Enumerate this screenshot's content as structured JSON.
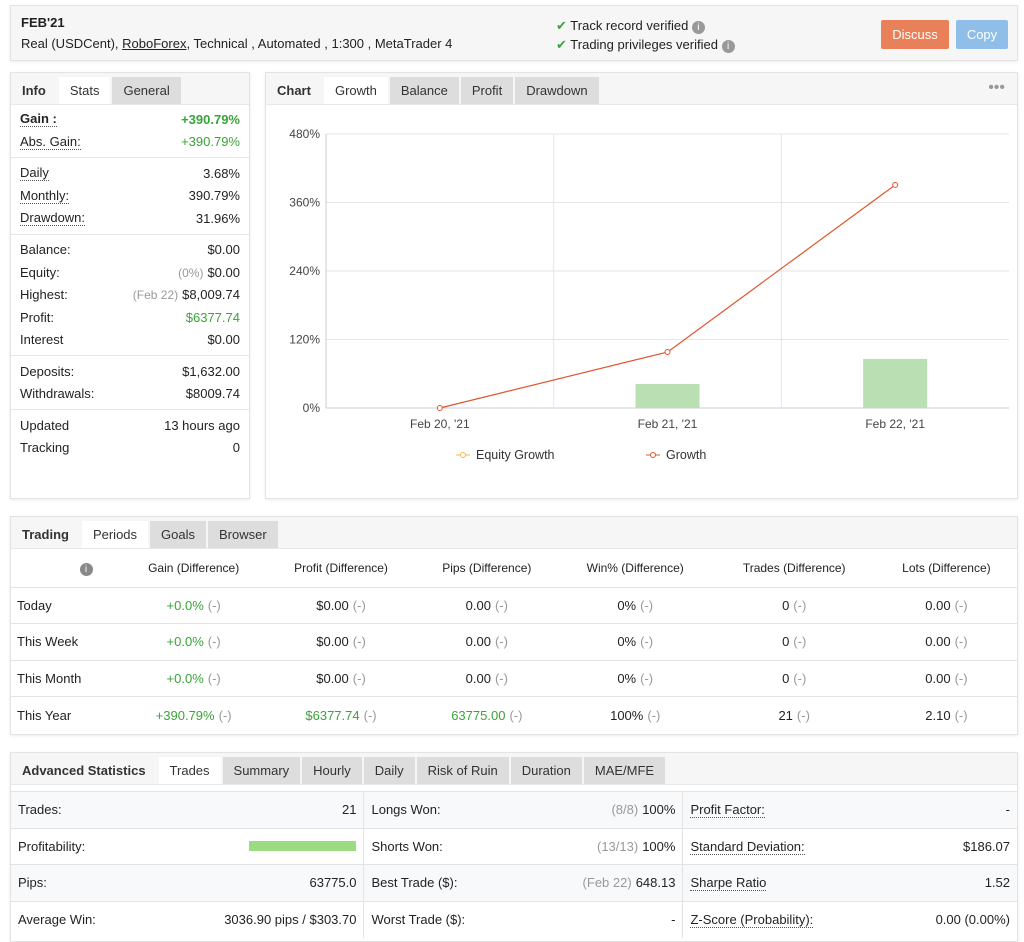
{
  "header": {
    "title": "FEB'21",
    "account_type": "Real (USDCent),",
    "broker": "RoboForex",
    "details": ", Technical , Automated , 1:300 , MetaTrader 4",
    "verified": [
      "Track record verified",
      "Trading privileges verified"
    ],
    "discuss": "Discuss",
    "copy": "Copy",
    "colors": {
      "discuss": "#e8805a",
      "copy": "#8fbfe9"
    }
  },
  "stats": {
    "tabs": [
      "Info",
      "Stats",
      "General"
    ],
    "active_tab": "Stats",
    "groups": [
      [
        {
          "label": "Gain :",
          "value": "+390.79%",
          "green": true,
          "bold": true
        },
        {
          "label": "Abs. Gain:",
          "value": "+390.79%",
          "green": true
        }
      ],
      [
        {
          "label": "Daily",
          "value": "3.68%"
        },
        {
          "label": "Monthly:",
          "value": "390.79%"
        },
        {
          "label": "Drawdown:",
          "value": "31.96%"
        }
      ],
      [
        {
          "label": "Balance:",
          "value": "$0.00"
        },
        {
          "label": "Equity:",
          "note": "(0%)",
          "value": "$0.00"
        },
        {
          "label": "Highest:",
          "note": "(Feb 22)",
          "value": "$8,009.74"
        },
        {
          "label": "Profit:",
          "value": "$6377.74",
          "green": true
        },
        {
          "label": "Interest",
          "value": "$0.00"
        }
      ],
      [
        {
          "label": "Deposits:",
          "value": "$1,632.00"
        },
        {
          "label": "Withdrawals:",
          "value": "$8009.74"
        }
      ],
      [
        {
          "label": "Updated",
          "value": "13 hours ago"
        },
        {
          "label": "Tracking",
          "value": "0"
        }
      ]
    ]
  },
  "chart": {
    "tabs": [
      "Chart",
      "Growth",
      "Balance",
      "Profit",
      "Drawdown"
    ],
    "active_tab": "Growth",
    "menu_icon": "more-dots-icon"
  },
  "chart_data": {
    "type": "line",
    "categories": [
      "Feb 20, '21",
      "Feb 21, '21",
      "Feb 22, '21"
    ],
    "ylim": [
      0,
      480
    ],
    "yticks": [
      "0%",
      "120%",
      "240%",
      "360%",
      "480%"
    ],
    "grid": true,
    "legend_position": "bottom",
    "series": [
      {
        "name": "Equity Growth",
        "color": "#f5b74a",
        "values": []
      },
      {
        "name": "Growth",
        "color": "#e2542c",
        "values": [
          0,
          98,
          390.79
        ]
      },
      {
        "type": "bar",
        "color": "#b9dfb2",
        "values": [
          0,
          42,
          86
        ]
      }
    ]
  },
  "trading": {
    "tabs": [
      "Trading",
      "Periods",
      "Goals",
      "Browser"
    ],
    "active_tab": "Periods",
    "columns": [
      "Gain (Difference)",
      "Profit (Difference)",
      "Pips (Difference)",
      "Win% (Difference)",
      "Trades (Difference)",
      "Lots (Difference)"
    ],
    "rows": [
      {
        "label": "Today",
        "cells": [
          "+0.0%",
          "$0.00",
          "0.00",
          "0%",
          "0",
          "0.00"
        ]
      },
      {
        "label": "This Week",
        "cells": [
          "+0.0%",
          "$0.00",
          "0.00",
          "0%",
          "0",
          "0.00"
        ]
      },
      {
        "label": "This Month",
        "cells": [
          "+0.0%",
          "$0.00",
          "0.00",
          "0%",
          "0",
          "0.00"
        ]
      },
      {
        "label": "This Year",
        "cells": [
          "+390.79%",
          "$6377.74",
          "63775.00",
          "100%",
          "21",
          "2.10"
        ]
      }
    ],
    "diff": "(-)"
  },
  "advanced": {
    "tabs": [
      "Advanced Statistics",
      "Trades",
      "Summary",
      "Hourly",
      "Daily",
      "Risk of Ruin",
      "Duration",
      "MAE/MFE"
    ],
    "active_tab": "Trades",
    "profitability": 1.0,
    "rows": [
      [
        {
          "l": "Trades:",
          "v": "21"
        },
        {
          "l": "Longs Won:",
          "n": "(8/8)",
          "v": "100%"
        },
        {
          "l": "Profit Factor:",
          "v": "-"
        }
      ],
      [
        {
          "l": "Profitability:",
          "v": ""
        },
        {
          "l": "Shorts Won:",
          "n": "(13/13)",
          "v": "100%"
        },
        {
          "l": "Standard Deviation:",
          "v": "$186.07"
        }
      ],
      [
        {
          "l": "Pips:",
          "v": "63775.0"
        },
        {
          "l": "Best Trade ($):",
          "n": "(Feb 22)",
          "v": "648.13"
        },
        {
          "l": "Sharpe Ratio",
          "v": "1.52"
        }
      ],
      [
        {
          "l": "Average Win:",
          "v": "3036.90 pips / $303.70"
        },
        {
          "l": "Worst Trade ($):",
          "v": "-"
        },
        {
          "l": "Z-Score (Probability):",
          "v": "0.00 (0.00%)"
        }
      ]
    ]
  }
}
